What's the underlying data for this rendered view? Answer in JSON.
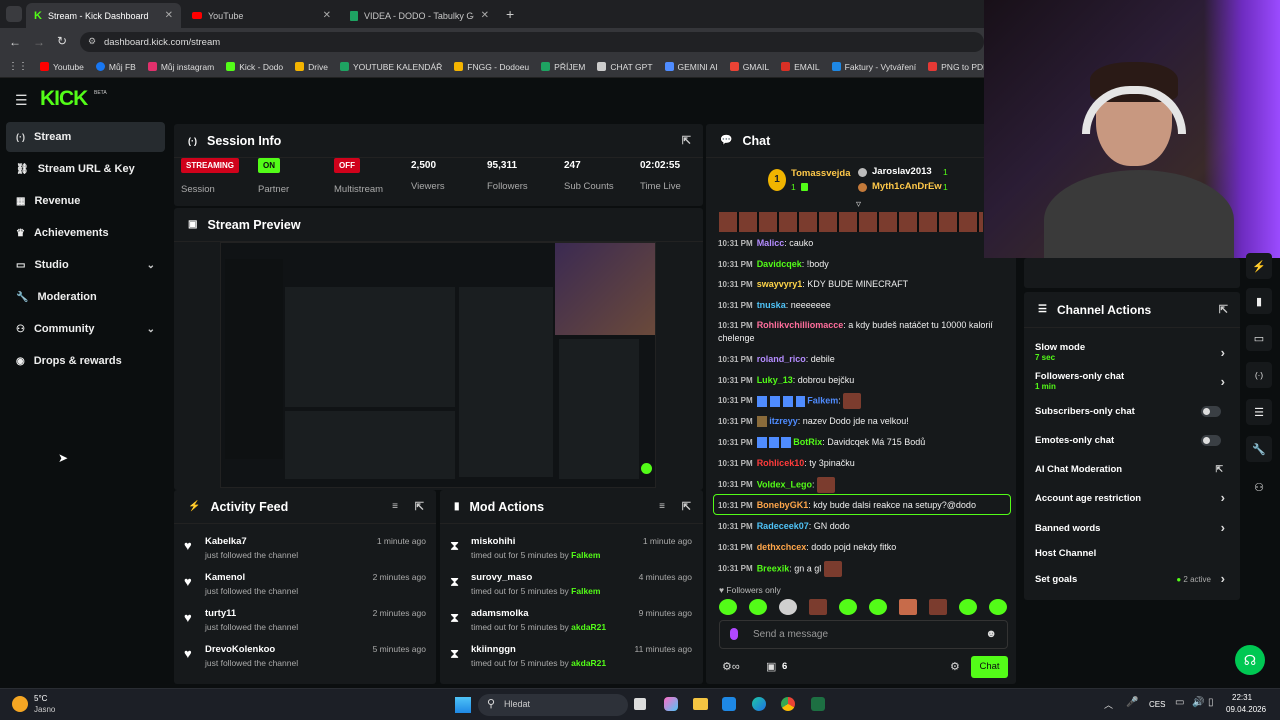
{
  "browser": {
    "tabs": [
      {
        "label": "Stream - Kick Dashboard",
        "icon": "kick-icon",
        "color": "#53fc18"
      },
      {
        "label": "YouTube",
        "icon": "youtube-icon",
        "color": "#ff0000"
      },
      {
        "label": "VIDEA - DODO - Tabulky Googl",
        "icon": "sheets-icon",
        "color": "#1ea362"
      }
    ],
    "url": "dashboard.kick.com/stream",
    "bookmarks": [
      {
        "label": "Youtube",
        "color": "#ff0000"
      },
      {
        "label": "Můj FB",
        "color": "#1877f2"
      },
      {
        "label": "Můj instagram",
        "color": "#e1306c"
      },
      {
        "label": "Kick - Dodo",
        "color": "#53fc18"
      },
      {
        "label": "Drive",
        "color": "#f4b400"
      },
      {
        "label": "YOUTUBE KALENDÁŘ",
        "color": "#1ea362"
      },
      {
        "label": "FNGG - Dodoeu",
        "color": "#f4b400"
      },
      {
        "label": "PŘÍJEM",
        "color": "#1ea362"
      },
      {
        "label": "CHAT GPT",
        "color": "#cccccc"
      },
      {
        "label": "GEMINI AI",
        "color": "#4f8cff"
      },
      {
        "label": "GMAIL",
        "color": "#ea4335"
      },
      {
        "label": "EMAIL",
        "color": "#d93025"
      },
      {
        "label": "Faktury - Vytváření",
        "color": "#1e88e5"
      },
      {
        "label": "PNG to PDF",
        "color": "#e53935"
      }
    ]
  },
  "app": {
    "logo": "KICK",
    "logo_sup": "BETA",
    "accent": "#53fc18"
  },
  "sidebar": {
    "items": [
      {
        "label": "Stream",
        "icon": "stream-icon",
        "glyph": "(·)"
      },
      {
        "label": "Stream URL & Key",
        "icon": "link-icon",
        "glyph": "🔗"
      },
      {
        "label": "Revenue",
        "icon": "chart-icon",
        "glyph": "▦"
      },
      {
        "label": "Achievements",
        "icon": "trophy-icon",
        "glyph": "🏆"
      },
      {
        "label": "Studio",
        "icon": "studio-icon",
        "glyph": "▭"
      },
      {
        "label": "Moderation",
        "icon": "wrench-icon",
        "glyph": "🔧"
      },
      {
        "label": "Community",
        "icon": "community-icon",
        "glyph": "👥"
      },
      {
        "label": "Drops & rewards",
        "icon": "drops-icon",
        "glyph": "◉"
      }
    ]
  },
  "session": {
    "title": "Session Info",
    "streaming_badge": "STREAMING",
    "session_label": "Session",
    "partner_badge": "ON",
    "partner_label": "Partner",
    "multistream_badge": "OFF",
    "multistream_label": "Multistream",
    "viewers": "2,500",
    "viewers_label": "Viewers",
    "followers": "95,311",
    "followers_label": "Followers",
    "subs": "247",
    "subs_label": "Sub Counts",
    "time": "02:02:55",
    "time_label": "Time Live"
  },
  "preview": {
    "title": "Stream Preview"
  },
  "activity": {
    "title": "Activity Feed",
    "items": [
      {
        "name": "Kabelka7",
        "sub": "just followed the channel",
        "time": "1 minute ago"
      },
      {
        "name": "Kamenol",
        "sub": "just followed the channel",
        "time": "2 minutes ago"
      },
      {
        "name": "turty11",
        "sub": "just followed the channel",
        "time": "2 minutes ago"
      },
      {
        "name": "DrevoKolenkoo",
        "sub": "just followed the channel",
        "time": "5 minutes ago"
      }
    ]
  },
  "mod": {
    "title": "Mod Actions",
    "items": [
      {
        "name": "miskohihi",
        "sub": "timed out for 5 minutes by",
        "by": "Falkem",
        "time": "1 minute ago"
      },
      {
        "name": "surovy_maso",
        "sub": "timed out for 5 minutes by",
        "by": "Falkem",
        "time": "4 minutes ago"
      },
      {
        "name": "adamsmolka",
        "sub": "timed out for 5 minutes by",
        "by": "akdaR21",
        "time": "9 minutes ago"
      },
      {
        "name": "kkiinnggn",
        "sub": "timed out for 5 minutes by",
        "by": "akdaR21",
        "time": "11 minutes ago"
      }
    ]
  },
  "chat": {
    "title": "Chat",
    "top_rank": "1",
    "top_user": "Tomassvejda",
    "top_user_count": "1",
    "top2_user": "Jaroslav2013",
    "top2_count": "1",
    "top3_user": "Myth1cAnDrEw",
    "top3_count": "1",
    "messages": [
      {
        "time": "10:31 PM",
        "user": "Malicc",
        "color": "#b48cff",
        "text": ": cauko"
      },
      {
        "time": "10:31 PM",
        "user": "Davidcqek",
        "color": "#53fc18",
        "text": ": !body"
      },
      {
        "time": "10:31 PM",
        "user": "swayvyry1",
        "color": "#ffd54a",
        "text": ": KDY BUDE MINECRAFT"
      },
      {
        "time": "10:31 PM",
        "user": "tnuska",
        "color": "#4fc3f7",
        "text": ": neeeeeee"
      },
      {
        "time": "10:31 PM",
        "user": "Rohlikvchilliomacce",
        "color": "#ff6e9c",
        "text": ": a kdy budeš natáčet tu 10000 kalorií chelenge"
      },
      {
        "time": "10:31 PM",
        "user": "roland_rico",
        "color": "#b48cff",
        "text": ": debile"
      },
      {
        "time": "10:31 PM",
        "user": "Luky_13",
        "color": "#53fc18",
        "text": ": dobrou bejčku"
      },
      {
        "time": "10:31 PM",
        "user": "Falkem",
        "color": "#4f8cff",
        "text": ":"
      },
      {
        "time": "10:31 PM",
        "user": "itzreyy",
        "color": "#4f8cff",
        "text": ": nazev Dodo jde na velkou!"
      },
      {
        "time": "10:31 PM",
        "user": "BotRix",
        "color": "#53fc18",
        "text": ": Davidcqek Má 715 Bodů"
      },
      {
        "time": "10:31 PM",
        "user": "Rohlicek10",
        "color": "#ff3b3b",
        "text": ": ty 3pinačku"
      },
      {
        "time": "10:31 PM",
        "user": "Voldex_Lego",
        "color": "#53fc18",
        "text": ":"
      },
      {
        "time": "10:31 PM",
        "user": "BonebyGK1",
        "color": "#ffa64a",
        "text": ": kdy bude dalsi reakce na setupy?@dodo"
      },
      {
        "time": "10:31 PM",
        "user": "Radeceek07",
        "color": "#4fc3f7",
        "text": ": GN dodo"
      },
      {
        "time": "10:31 PM",
        "user": "dethxchcex",
        "color": "#ffa64a",
        "text": ": dodo pojd nekdy fitko"
      },
      {
        "time": "10:31 PM",
        "user": "Breexik",
        "color": "#53fc18",
        "text": ": gn a gl"
      }
    ],
    "followers_only": "Followers only",
    "placeholder": "Send a message",
    "count": "6",
    "send": "Chat"
  },
  "channel_actions": {
    "title": "Channel Actions",
    "slow_mode": "Slow mode",
    "slow_mode_val": "7 sec",
    "followers_only": "Followers-only chat",
    "followers_only_val": "1 min",
    "subs_only": "Subscribers-only chat",
    "emotes_only": "Emotes-only chat",
    "ai_mod": "AI Chat Moderation",
    "age": "Account age restriction",
    "banned": "Banned words",
    "host": "Host Channel",
    "goals": "Set goals",
    "goals_val": "2 active"
  },
  "taskbar": {
    "weather_temp": "5°C",
    "weather_desc": "Jasno",
    "search": "Hledat",
    "lang": "CES",
    "time": "22:31",
    "date": "09.04.2026"
  }
}
